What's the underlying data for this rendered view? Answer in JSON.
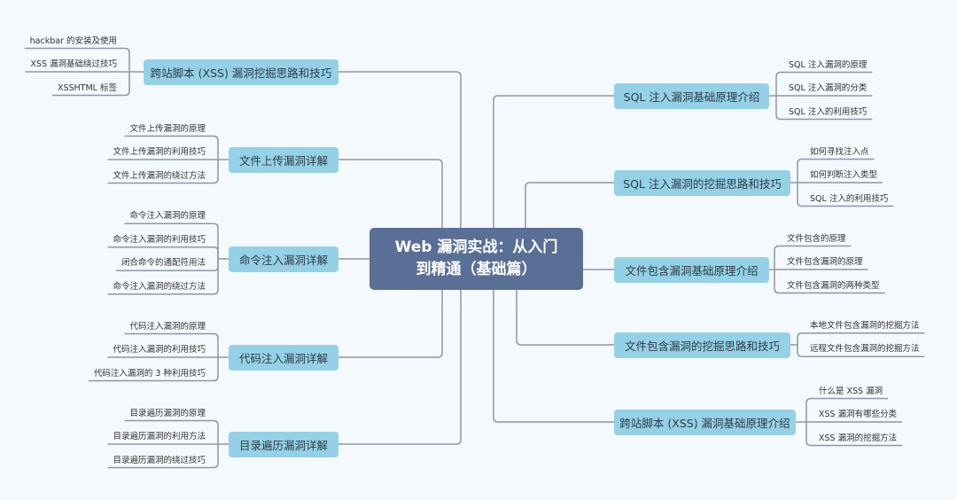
{
  "root": {
    "line1": "Web 漏洞实战：从入门",
    "line2": "到精通（基础篇）"
  },
  "colors": {
    "root": "#5a6f96",
    "branch": "#94d1e6",
    "line": "#8e96a8",
    "background": "#f4f9fd"
  },
  "left_branches": [
    {
      "label": "跨站脚本 (XSS) 漏洞挖掘思路和技巧",
      "leaves": [
        "hackbar 的安装及使用",
        "XSS 漏洞基础绕过技巧",
        "XSSHTML 标签"
      ]
    },
    {
      "label": "文件上传漏洞详解",
      "leaves": [
        "文件上传漏洞的原理",
        "文件上传漏洞的利用技巧",
        "文件上传漏洞的绕过方法"
      ]
    },
    {
      "label": "命令注入漏洞详解",
      "leaves": [
        "命令注入漏洞的原理",
        "命令注入漏洞的利用技巧",
        "闭合命令的通配符用法",
        "命令注入漏洞的绕过方法"
      ]
    },
    {
      "label": "代码注入漏洞详解",
      "leaves": [
        "代码注入漏洞的原理",
        "代码注入漏洞的利用技巧",
        "代码注入漏洞的 3 种利用技巧"
      ]
    },
    {
      "label": "目录遍历漏洞详解",
      "leaves": [
        "目录遍历漏洞的原理",
        "目录遍历漏洞的利用方法",
        "目录遍历漏洞的绕过技巧"
      ]
    }
  ],
  "right_branches": [
    {
      "label": "SQL 注入漏洞基础原理介绍",
      "leaves": [
        "SQL 注入漏洞的原理",
        "SQL 注入漏洞的分类",
        "SQL 注入的利用技巧"
      ]
    },
    {
      "label": "SQL 注入漏洞的挖掘思路和技巧",
      "leaves": [
        "如何寻找注入点",
        "如何判断注入类型",
        "SQL 注入的利用技巧"
      ]
    },
    {
      "label": "文件包含漏洞基础原理介绍",
      "leaves": [
        "文件包含的原理",
        "文件包含漏洞的原理",
        "文件包含漏洞的两种类型"
      ]
    },
    {
      "label": "文件包含漏洞的挖掘思路和技巧",
      "leaves": [
        "本地文件包含漏洞的挖掘方法",
        "远程文件包含漏洞的挖掘方法"
      ]
    },
    {
      "label": "跨站脚本 (XSS) 漏洞基础原理介绍",
      "leaves": [
        "什么是 XSS 漏洞",
        "XSS 漏洞有哪些分类",
        "XSS 漏洞的挖掘方法"
      ]
    }
  ]
}
